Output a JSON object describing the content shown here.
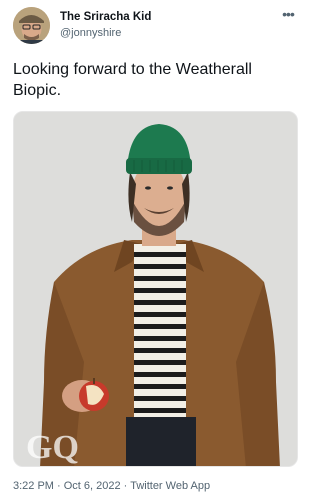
{
  "tweet": {
    "author": {
      "display_name": "The Sriracha Kid",
      "handle": "@jonnyshire"
    },
    "more_icon": "more-horizontal-icon",
    "text": "Looking forward to the Weatherall Biopic.",
    "media": {
      "watermark": "GQ"
    },
    "timestamp": {
      "time": "3:22 PM",
      "separator": " · ",
      "date": "Oct 6, 2022",
      "separator2": " · ",
      "source": "Twitter Web App"
    }
  }
}
